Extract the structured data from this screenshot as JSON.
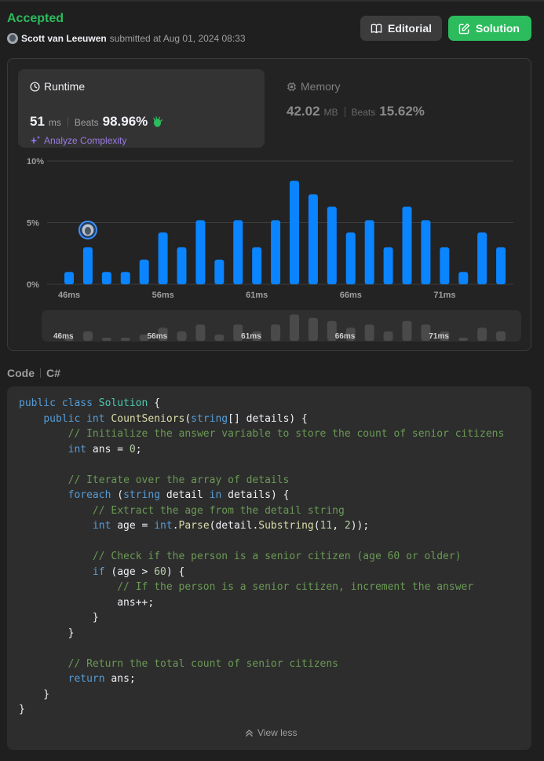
{
  "header": {
    "status": "Accepted",
    "user": "Scott van Leeuwen",
    "submitted_text": "submitted at Aug 01, 2024 08:33",
    "editorial_label": "Editorial",
    "solution_label": "Solution"
  },
  "runtime": {
    "title": "Runtime",
    "value": "51",
    "unit": "ms",
    "beats_label": "Beats",
    "beats_value": "98.96%",
    "analyze_label": "Analyze Complexity"
  },
  "memory": {
    "title": "Memory",
    "value": "42.02",
    "unit": "MB",
    "beats_label": "Beats",
    "beats_value": "15.62%"
  },
  "chart_data": {
    "type": "bar",
    "y_tick_labels": [
      "10%",
      "5%",
      "0%"
    ],
    "ylim": [
      0,
      10
    ],
    "x_tick_labels": [
      "46ms",
      "56ms",
      "61ms",
      "66ms",
      "71ms"
    ],
    "values": [
      1,
      3,
      1,
      1,
      2,
      4.2,
      3,
      5.2,
      2,
      5.2,
      3,
      5.2,
      8.4,
      7.3,
      6.3,
      4.2,
      5.2,
      3,
      6.3,
      5.2,
      3,
      1,
      4.2,
      3
    ],
    "user_bar_index": 1,
    "bar_color": "#0a84ff",
    "grid": true
  },
  "code": {
    "label": "Code",
    "language": "C#",
    "view_less": "View less",
    "lines": [
      [
        [
          "kw",
          "public"
        ],
        [
          "t",
          " "
        ],
        [
          "kw",
          "class"
        ],
        [
          "t",
          " "
        ],
        [
          "ty",
          "Solution"
        ],
        [
          "t",
          " {"
        ]
      ],
      [
        [
          "t",
          "    "
        ],
        [
          "kw",
          "public"
        ],
        [
          "t",
          " "
        ],
        [
          "kw",
          "int"
        ],
        [
          "t",
          " "
        ],
        [
          "fn",
          "CountSeniors"
        ],
        [
          "t",
          "("
        ],
        [
          "kw",
          "string"
        ],
        [
          "t",
          "[] details) {"
        ]
      ],
      [
        [
          "t",
          "        "
        ],
        [
          "cm",
          "// Initialize the answer variable to store the count of senior citizens"
        ]
      ],
      [
        [
          "t",
          "        "
        ],
        [
          "kw",
          "int"
        ],
        [
          "t",
          " ans = "
        ],
        [
          "nu",
          "0"
        ],
        [
          "t",
          ";"
        ]
      ],
      [
        [
          "t",
          ""
        ]
      ],
      [
        [
          "t",
          "        "
        ],
        [
          "cm",
          "// Iterate over the array of details"
        ]
      ],
      [
        [
          "t",
          "        "
        ],
        [
          "kw",
          "foreach"
        ],
        [
          "t",
          " ("
        ],
        [
          "kw",
          "string"
        ],
        [
          "t",
          " detail "
        ],
        [
          "kw",
          "in"
        ],
        [
          "t",
          " details) {"
        ]
      ],
      [
        [
          "t",
          "            "
        ],
        [
          "cm",
          "// Extract the age from the detail string"
        ]
      ],
      [
        [
          "t",
          "            "
        ],
        [
          "kw",
          "int"
        ],
        [
          "t",
          " age = "
        ],
        [
          "kw",
          "int"
        ],
        [
          "t",
          "."
        ],
        [
          "fn",
          "Parse"
        ],
        [
          "t",
          "(detail."
        ],
        [
          "fn",
          "Substring"
        ],
        [
          "t",
          "("
        ],
        [
          "nu",
          "11"
        ],
        [
          "t",
          ", "
        ],
        [
          "nu",
          "2"
        ],
        [
          "t",
          "));"
        ]
      ],
      [
        [
          "t",
          ""
        ]
      ],
      [
        [
          "t",
          "            "
        ],
        [
          "cm",
          "// Check if the person is a senior citizen (age 60 or older)"
        ]
      ],
      [
        [
          "t",
          "            "
        ],
        [
          "kw",
          "if"
        ],
        [
          "t",
          " (age > "
        ],
        [
          "nu",
          "60"
        ],
        [
          "t",
          ") {"
        ]
      ],
      [
        [
          "t",
          "                "
        ],
        [
          "cm",
          "// If the person is a senior citizen, increment the answer"
        ]
      ],
      [
        [
          "t",
          "                ans++;"
        ]
      ],
      [
        [
          "t",
          "            }"
        ]
      ],
      [
        [
          "t",
          "        }"
        ]
      ],
      [
        [
          "t",
          ""
        ]
      ],
      [
        [
          "t",
          "        "
        ],
        [
          "cm",
          "// Return the total count of senior citizens"
        ]
      ],
      [
        [
          "t",
          "        "
        ],
        [
          "kw",
          "return"
        ],
        [
          "t",
          " ans;"
        ]
      ],
      [
        [
          "t",
          "    }"
        ]
      ],
      [
        [
          "t",
          "}"
        ]
      ]
    ]
  }
}
